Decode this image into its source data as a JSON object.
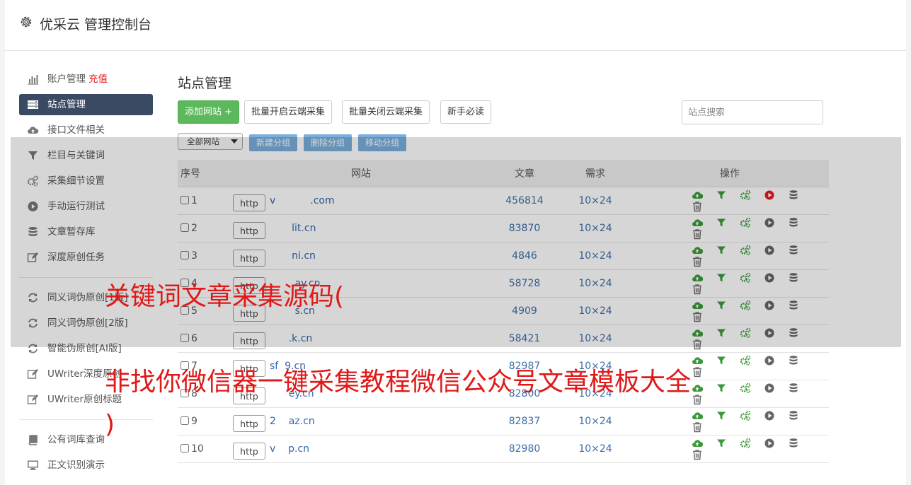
{
  "header": {
    "title": "优采云 管理控制台"
  },
  "sidebar": {
    "items": [
      {
        "label": "账户管理",
        "extra": "充值",
        "icon": "bar-chart-icon"
      },
      {
        "label": "站点管理",
        "icon": "server-icon"
      },
      {
        "label": "接口文件相关",
        "icon": "cloud-upload-icon"
      },
      {
        "label": "栏目与关键词",
        "icon": "filter-icon"
      },
      {
        "label": "采集细节设置",
        "icon": "gears-icon"
      },
      {
        "label": "手动运行测试",
        "icon": "play-circle-icon"
      },
      {
        "label": "文章暂存库",
        "icon": "database-icon"
      },
      {
        "label": "深度原创任务",
        "icon": "edit-icon"
      },
      {
        "label": "同义词伪原创[1版]",
        "icon": "refresh-icon"
      },
      {
        "label": "同义词伪原创[2版]",
        "icon": "refresh-icon"
      },
      {
        "label": "智能伪原创[AI版]",
        "icon": "refresh-icon"
      },
      {
        "label": "UWriter深度原创",
        "icon": "edit-icon"
      },
      {
        "label": "UWriter原创标题",
        "icon": "edit-icon"
      },
      {
        "label": "公有词库查询",
        "icon": "book-icon"
      },
      {
        "label": "正文识别演示",
        "icon": "monitor-icon"
      }
    ]
  },
  "main": {
    "title": "站点管理",
    "buttons": {
      "add": "添加网站 +",
      "batch_open": "批量开启云端采集",
      "batch_close": "批量关闭云端采集",
      "guide": "新手必读"
    },
    "search_placeholder": "站点搜索",
    "group_select": "全部网站",
    "group_buttons": {
      "new": "新建分组",
      "delete": "删除分组",
      "move": "移动分组"
    },
    "table": {
      "headers": {
        "no": "序号",
        "site": "网站",
        "articles": "文章",
        "need": "需求",
        "ops": "操作"
      },
      "rows": [
        {
          "no": "1",
          "scheme": "http",
          "domain": "v           .com",
          "articles": "456814",
          "need": "10×24",
          "run_active": true
        },
        {
          "no": "2",
          "scheme": "http",
          "domain": "       lit.cn",
          "articles": "83870",
          "need": "10×24",
          "run_active": false
        },
        {
          "no": "3",
          "scheme": "http",
          "domain": "       ni.cn",
          "articles": "4846",
          "need": "10×24",
          "run_active": false
        },
        {
          "no": "4",
          "scheme": "http",
          "domain": "        ay.cn",
          "articles": "58728",
          "need": "10×24",
          "run_active": false
        },
        {
          "no": "5",
          "scheme": "http",
          "domain": "        s.cn",
          "articles": "4909",
          "need": "10×24",
          "run_active": false
        },
        {
          "no": "6",
          "scheme": "http",
          "domain": "      .k.cn",
          "articles": "58421",
          "need": "10×24",
          "run_active": false
        },
        {
          "no": "7",
          "scheme": "http",
          "domain": "sf  9.cn",
          "articles": "82987",
          "need": "10×24",
          "run_active": false
        },
        {
          "no": "8",
          "scheme": "http",
          "domain": "      ey.cn",
          "articles": "82800",
          "need": "10×24",
          "run_active": false
        },
        {
          "no": "9",
          "scheme": "http",
          "domain": "2    az.cn",
          "articles": "82837",
          "need": "10×24",
          "run_active": false
        },
        {
          "no": "10",
          "scheme": "http",
          "domain": "v    p.cn",
          "articles": "82980",
          "need": "10×24",
          "run_active": false
        }
      ]
    }
  },
  "overlay": {
    "line1": "关键词文章采集源码(",
    "line2": "非找你微信器一键采集教程微信公众号文章模板大全",
    "line3": ")"
  },
  "colors": {
    "sidebar_active": "#3b4a63",
    "add_button": "#5cb85c",
    "group_button": "#7aaedc",
    "link": "#3d6ea8",
    "run_active": "#e02020",
    "op_green": "#3a9a3a"
  }
}
